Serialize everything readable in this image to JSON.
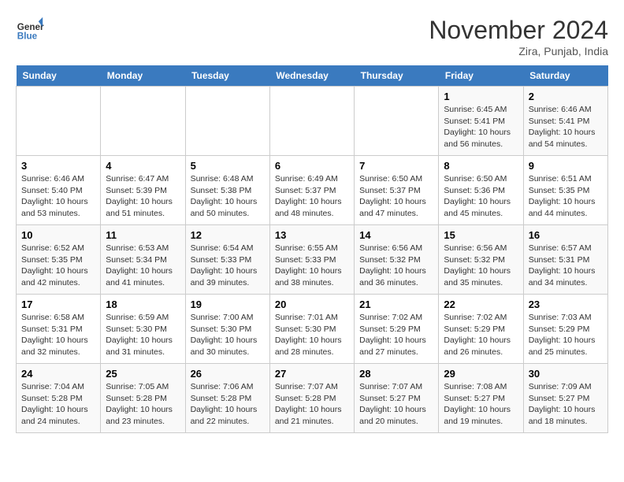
{
  "header": {
    "logo_line1": "General",
    "logo_line2": "Blue",
    "month": "November 2024",
    "location": "Zira, Punjab, India"
  },
  "weekdays": [
    "Sunday",
    "Monday",
    "Tuesday",
    "Wednesday",
    "Thursday",
    "Friday",
    "Saturday"
  ],
  "weeks": [
    [
      {
        "day": "",
        "info": ""
      },
      {
        "day": "",
        "info": ""
      },
      {
        "day": "",
        "info": ""
      },
      {
        "day": "",
        "info": ""
      },
      {
        "day": "",
        "info": ""
      },
      {
        "day": "1",
        "info": "Sunrise: 6:45 AM\nSunset: 5:41 PM\nDaylight: 10 hours\nand 56 minutes."
      },
      {
        "day": "2",
        "info": "Sunrise: 6:46 AM\nSunset: 5:41 PM\nDaylight: 10 hours\nand 54 minutes."
      }
    ],
    [
      {
        "day": "3",
        "info": "Sunrise: 6:46 AM\nSunset: 5:40 PM\nDaylight: 10 hours\nand 53 minutes."
      },
      {
        "day": "4",
        "info": "Sunrise: 6:47 AM\nSunset: 5:39 PM\nDaylight: 10 hours\nand 51 minutes."
      },
      {
        "day": "5",
        "info": "Sunrise: 6:48 AM\nSunset: 5:38 PM\nDaylight: 10 hours\nand 50 minutes."
      },
      {
        "day": "6",
        "info": "Sunrise: 6:49 AM\nSunset: 5:37 PM\nDaylight: 10 hours\nand 48 minutes."
      },
      {
        "day": "7",
        "info": "Sunrise: 6:50 AM\nSunset: 5:37 PM\nDaylight: 10 hours\nand 47 minutes."
      },
      {
        "day": "8",
        "info": "Sunrise: 6:50 AM\nSunset: 5:36 PM\nDaylight: 10 hours\nand 45 minutes."
      },
      {
        "day": "9",
        "info": "Sunrise: 6:51 AM\nSunset: 5:35 PM\nDaylight: 10 hours\nand 44 minutes."
      }
    ],
    [
      {
        "day": "10",
        "info": "Sunrise: 6:52 AM\nSunset: 5:35 PM\nDaylight: 10 hours\nand 42 minutes."
      },
      {
        "day": "11",
        "info": "Sunrise: 6:53 AM\nSunset: 5:34 PM\nDaylight: 10 hours\nand 41 minutes."
      },
      {
        "day": "12",
        "info": "Sunrise: 6:54 AM\nSunset: 5:33 PM\nDaylight: 10 hours\nand 39 minutes."
      },
      {
        "day": "13",
        "info": "Sunrise: 6:55 AM\nSunset: 5:33 PM\nDaylight: 10 hours\nand 38 minutes."
      },
      {
        "day": "14",
        "info": "Sunrise: 6:56 AM\nSunset: 5:32 PM\nDaylight: 10 hours\nand 36 minutes."
      },
      {
        "day": "15",
        "info": "Sunrise: 6:56 AM\nSunset: 5:32 PM\nDaylight: 10 hours\nand 35 minutes."
      },
      {
        "day": "16",
        "info": "Sunrise: 6:57 AM\nSunset: 5:31 PM\nDaylight: 10 hours\nand 34 minutes."
      }
    ],
    [
      {
        "day": "17",
        "info": "Sunrise: 6:58 AM\nSunset: 5:31 PM\nDaylight: 10 hours\nand 32 minutes."
      },
      {
        "day": "18",
        "info": "Sunrise: 6:59 AM\nSunset: 5:30 PM\nDaylight: 10 hours\nand 31 minutes."
      },
      {
        "day": "19",
        "info": "Sunrise: 7:00 AM\nSunset: 5:30 PM\nDaylight: 10 hours\nand 30 minutes."
      },
      {
        "day": "20",
        "info": "Sunrise: 7:01 AM\nSunset: 5:30 PM\nDaylight: 10 hours\nand 28 minutes."
      },
      {
        "day": "21",
        "info": "Sunrise: 7:02 AM\nSunset: 5:29 PM\nDaylight: 10 hours\nand 27 minutes."
      },
      {
        "day": "22",
        "info": "Sunrise: 7:02 AM\nSunset: 5:29 PM\nDaylight: 10 hours\nand 26 minutes."
      },
      {
        "day": "23",
        "info": "Sunrise: 7:03 AM\nSunset: 5:29 PM\nDaylight: 10 hours\nand 25 minutes."
      }
    ],
    [
      {
        "day": "24",
        "info": "Sunrise: 7:04 AM\nSunset: 5:28 PM\nDaylight: 10 hours\nand 24 minutes."
      },
      {
        "day": "25",
        "info": "Sunrise: 7:05 AM\nSunset: 5:28 PM\nDaylight: 10 hours\nand 23 minutes."
      },
      {
        "day": "26",
        "info": "Sunrise: 7:06 AM\nSunset: 5:28 PM\nDaylight: 10 hours\nand 22 minutes."
      },
      {
        "day": "27",
        "info": "Sunrise: 7:07 AM\nSunset: 5:28 PM\nDaylight: 10 hours\nand 21 minutes."
      },
      {
        "day": "28",
        "info": "Sunrise: 7:07 AM\nSunset: 5:27 PM\nDaylight: 10 hours\nand 20 minutes."
      },
      {
        "day": "29",
        "info": "Sunrise: 7:08 AM\nSunset: 5:27 PM\nDaylight: 10 hours\nand 19 minutes."
      },
      {
        "day": "30",
        "info": "Sunrise: 7:09 AM\nSunset: 5:27 PM\nDaylight: 10 hours\nand 18 minutes."
      }
    ]
  ]
}
